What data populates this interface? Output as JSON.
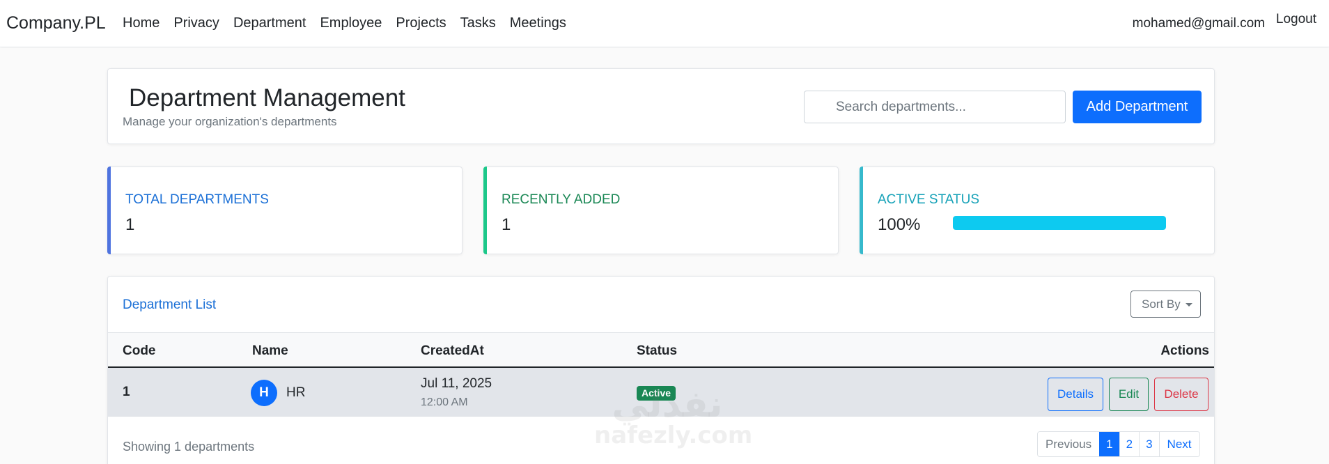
{
  "nav": {
    "brand": "Company.PL",
    "links": [
      "Home",
      "Privacy",
      "Department",
      "Employee",
      "Projects",
      "Tasks",
      "Meetings"
    ],
    "user_email": "mohamed@gmail.com",
    "logout": "Logout"
  },
  "header": {
    "title": "Department Management",
    "subtitle": "Manage your organization's departments",
    "search_placeholder": "Search departments...",
    "add_button": "Add Department"
  },
  "stats": [
    {
      "label": "TOTAL DEPARTMENTS",
      "value": "1",
      "color": "#4e73df"
    },
    {
      "label": "RECENTLY ADDED",
      "value": "1",
      "color": "#1cc88a"
    },
    {
      "label": "ACTIVE STATUS",
      "value": "100%",
      "color": "#36b9cc",
      "progress": 100
    }
  ],
  "list": {
    "title": "Department List",
    "sort_label": "Sort By",
    "columns": [
      "Code",
      "Name",
      "CreatedAt",
      "Status",
      "Actions"
    ],
    "rows": [
      {
        "code": "1",
        "initial": "H",
        "name": "HR",
        "date": "Jul 11, 2025",
        "time": "12:00 AM",
        "status": "Active",
        "actions": [
          "Details",
          "Edit",
          "Delete"
        ]
      }
    ],
    "footer": "Showing 1 departments",
    "pagination": {
      "previous": "Previous",
      "pages": [
        "1",
        "2",
        "3"
      ],
      "next": "Next",
      "current": "1"
    }
  },
  "watermark": {
    "arabic": "نفذلي",
    "latin": "nafezly.com"
  },
  "colors": {
    "primary": "#0d6efd",
    "success": "#198754",
    "danger": "#dc3545",
    "info": "#0dcaf0"
  }
}
